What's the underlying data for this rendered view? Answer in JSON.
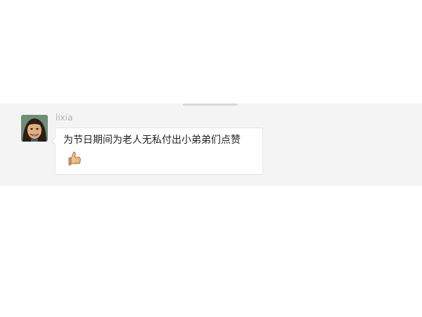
{
  "chat": {
    "message": {
      "sender_name": "lixia",
      "text": "为节日期间为老人无私付出小弟弟们点赞",
      "emoji_icon": "thumbs-up-icon"
    }
  },
  "colors": {
    "band_background": "#f4f4f4",
    "bubble_background": "#ffffff",
    "bubble_border": "#e6e6e6",
    "name_text": "#b3b3b3",
    "message_text": "#222222"
  }
}
